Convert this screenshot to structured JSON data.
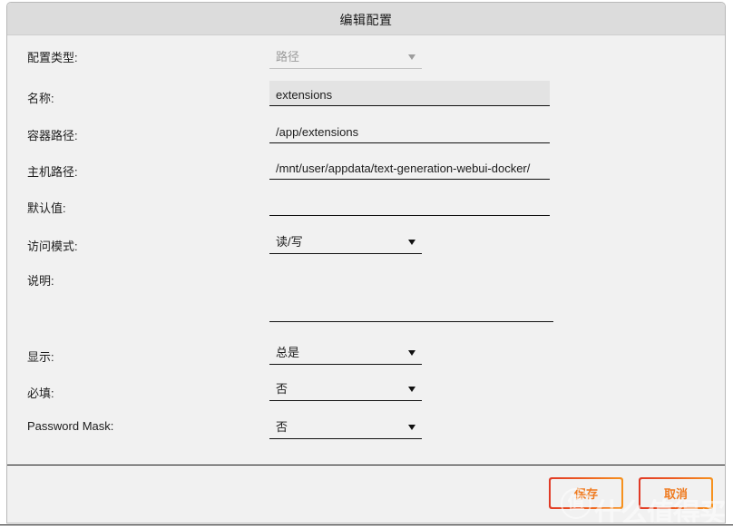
{
  "dialog": {
    "title": "编辑配置"
  },
  "fields": [
    {
      "label": "配置类型:",
      "type": "select",
      "value": "路径",
      "disabled": true
    },
    {
      "label": "名称:",
      "type": "text",
      "value": "extensions",
      "focused": true
    },
    {
      "label": "容器路径:",
      "type": "text",
      "value": "/app/extensions"
    },
    {
      "label": "主机路径:",
      "type": "text",
      "value": "/mnt/user/appdata/text-generation-webui-docker/"
    },
    {
      "label": "默认值:",
      "type": "text",
      "value": ""
    },
    {
      "label": "访问模式:",
      "type": "select",
      "value": "读/写"
    },
    {
      "label": "说明:",
      "type": "textarea",
      "value": ""
    },
    {
      "label": "显示:",
      "type": "select",
      "value": "总是"
    },
    {
      "label": "必填:",
      "type": "select",
      "value": "否"
    },
    {
      "label": "Password Mask:",
      "type": "select",
      "value": "否"
    }
  ],
  "footer": {
    "save_label": "保存",
    "cancel_label": "取消"
  },
  "watermark": {
    "badge": "值",
    "text": "什么值得买"
  },
  "colors": {
    "accent_start": "#e03a26",
    "accent_end": "#f6921e",
    "button_text": "#ef7b20",
    "titlebar": "#dcdcdc",
    "body": "#f1f1f1"
  }
}
